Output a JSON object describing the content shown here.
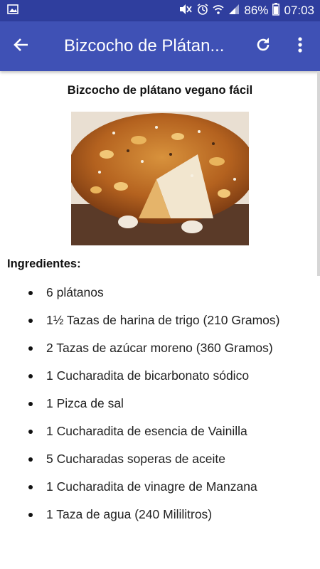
{
  "status_bar": {
    "battery_percent": "86%",
    "time": "07:03",
    "icons": [
      "image-icon",
      "mute-icon",
      "alarm-icon",
      "wifi-icon",
      "signal-icon",
      "battery-icon"
    ]
  },
  "app_bar": {
    "title": "Bizcocho de Plátan...",
    "icons": [
      "back-arrow-icon",
      "refresh-icon",
      "more-vert-icon"
    ],
    "color": "#3f51b5",
    "status_color": "#2f3e9e"
  },
  "recipe": {
    "title": "Bizcocho de plátano vegano fácil",
    "image_name": "banana-cake-photo",
    "ingredients_heading": "Ingredientes:",
    "ingredients": [
      "6 plátanos",
      "1½ Tazas de harina de trigo (210 Gramos)",
      "2 Tazas de azúcar moreno (360 Gramos)",
      "1 Cucharadita de bicarbonato sódico",
      "1 Pizca de sal",
      "1 Cucharadita de esencia de Vainilla",
      "5 Cucharadas soperas de aceite",
      "1 Cucharadita de vinagre de Manzana",
      "1 Taza de agua (240 Mililitros)"
    ]
  }
}
